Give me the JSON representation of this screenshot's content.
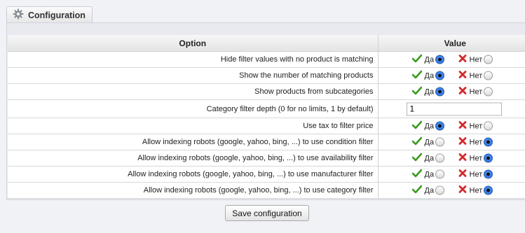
{
  "panel": {
    "title": "Configuration",
    "icon": "gear-icon"
  },
  "table": {
    "headers": {
      "option": "Option",
      "value": "Value"
    },
    "rows": [
      {
        "label": "Hide filter values with no product is matching",
        "type": "radio",
        "yes_label": "Да",
        "no_label": "Нет",
        "selected": "yes"
      },
      {
        "label": "Show the number of matching products",
        "type": "radio",
        "yes_label": "Да",
        "no_label": "Нет",
        "selected": "yes"
      },
      {
        "label": "Show products from subcategories",
        "type": "radio",
        "yes_label": "Да",
        "no_label": "Нет",
        "selected": "yes"
      },
      {
        "label": "Category filter depth (0 for no limits, 1 by default)",
        "type": "text",
        "value": "1"
      },
      {
        "label": "Use tax to filter price",
        "type": "radio",
        "yes_label": "Да",
        "no_label": "Нет",
        "selected": "yes"
      },
      {
        "label": "Allow indexing robots (google, yahoo, bing, ...) to use condition filter",
        "type": "radio",
        "yes_label": "Да",
        "no_label": "Нет",
        "selected": "no"
      },
      {
        "label": "Allow indexing robots (google, yahoo, bing, ...) to use availability filter",
        "type": "radio",
        "yes_label": "Да",
        "no_label": "Нет",
        "selected": "no"
      },
      {
        "label": "Allow indexing robots (google, yahoo, bing, ...) to use manufacturer filter",
        "type": "radio",
        "yes_label": "Да",
        "no_label": "Нет",
        "selected": "no"
      },
      {
        "label": "Allow indexing robots (google, yahoo, bing, ...) to use category filter",
        "type": "radio",
        "yes_label": "Да",
        "no_label": "Нет",
        "selected": "no"
      }
    ]
  },
  "save_button": {
    "label": "Save configuration"
  },
  "colors": {
    "check": "#3a9a1e",
    "cross": "#d42a2a",
    "radio_selected": "#1d63d6"
  }
}
